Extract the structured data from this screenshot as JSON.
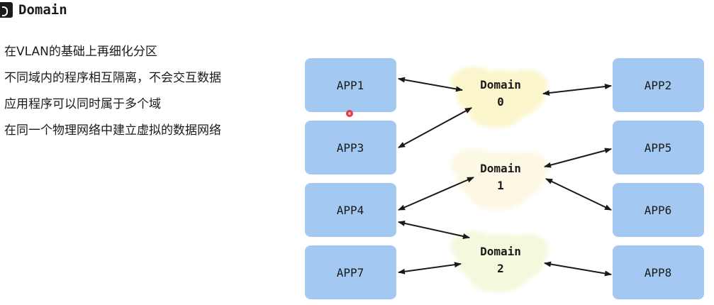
{
  "header": {
    "title": "Domain",
    "icon": "slide-marker-icon"
  },
  "bullets": [
    "在VLAN的基础上再细化分区",
    "不同域内的程序相互隔离，不会交互数据",
    "应用程序可以同时属于多个域",
    "在同一个物理网络中建立虚拟的数据网络"
  ],
  "diagram": {
    "apps": [
      "APP1",
      "APP3",
      "APP4",
      "APP7",
      "APP2",
      "APP5",
      "APP6",
      "APP8"
    ],
    "domains": [
      {
        "name": "Domain",
        "id": "0",
        "color": "#fbf6cc"
      },
      {
        "name": "Domain",
        "id": "1",
        "color": "#fdf8e4"
      },
      {
        "name": "Domain",
        "id": "2",
        "color": "#f2f9dc"
      }
    ],
    "links": [
      [
        "APP1",
        "Domain 0"
      ],
      [
        "APP3",
        "Domain 0"
      ],
      [
        "Domain 0",
        "APP2"
      ],
      [
        "APP4",
        "Domain 1"
      ],
      [
        "Domain 1",
        "APP5"
      ],
      [
        "Domain 1",
        "APP6"
      ],
      [
        "APP4",
        "Domain 2"
      ],
      [
        "APP7",
        "Domain 2"
      ],
      [
        "Domain 2",
        "APP8"
      ]
    ],
    "colors": {
      "app_box": "#a3c8f2",
      "arrow": "#1a1a1a"
    }
  },
  "cursor": {
    "icon": "cursor-dot-icon",
    "color": "#e23b3b"
  }
}
